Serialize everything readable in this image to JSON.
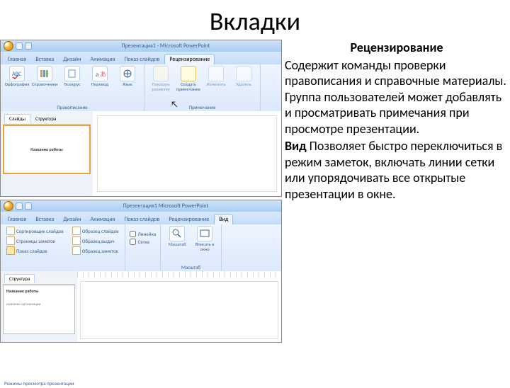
{
  "title": "Вкладки",
  "desc": {
    "review_title": "Рецензирование",
    "review_body": "Содержит команды проверки правописания и справочные материалы. Группа пользователей может добавлять и просматривать примечания при просмотре презентации.",
    "view_title": "Вид",
    "view_body": "   Позволяет быстро переключиться в режим заметок, включать линии сетки или упорядочивать все открытые презентации в окне."
  },
  "shot1": {
    "docTitle": "Презентация1 - Microsoft PowerPoint",
    "tabs": [
      "Главная",
      "Вставка",
      "Дизайн",
      "Анимация",
      "Показ слайдов",
      "Рецензирование"
    ],
    "activeTab": 5,
    "groups": [
      {
        "label": "Правописание",
        "btns": [
          "Орфография",
          "Справочники",
          "Тезаурус",
          "Перевод",
          "Язык"
        ]
      },
      {
        "label": "Примечания",
        "btns": [
          "Показать разметку",
          "Создать примечание",
          "Изменить",
          "Удалить"
        ]
      }
    ],
    "paneTabs": [
      "Слайды",
      "Структура"
    ],
    "activePane": 0,
    "thumbTitle": "Название работы"
  },
  "shot2": {
    "docTitle": "Презентация1  Microsoft PowerPoint",
    "tabs": [
      "Главная",
      "Вставка",
      "Дизайн",
      "Анимация",
      "Показ слайдов",
      "Рецензирование",
      "Вид"
    ],
    "activeTab": 6,
    "viewCol1": [
      {
        "ico": "slides",
        "label": "Сортировщик слайдов"
      },
      {
        "ico": "notes",
        "label": "Страницы заметок"
      },
      {
        "ico": "show",
        "label": "Показ слайдов"
      }
    ],
    "viewCol2": [
      {
        "ico": "master",
        "label": "Образец слайдов"
      },
      {
        "ico": "handout",
        "label": "Образец выдач"
      },
      {
        "ico": "notesm",
        "label": "Образец заметок"
      }
    ],
    "gridCol": [
      "Линейка",
      "Сетка"
    ],
    "zoomBtns": [
      "Масштаб",
      "Вписать в окно"
    ],
    "groupLabels": [
      "Режимы просмотра презентации",
      "",
      "Масштаб"
    ],
    "paneTabs": [
      "Структура"
    ],
    "thumb": {
      "title": "Название работы",
      "sub": "название организации"
    }
  }
}
